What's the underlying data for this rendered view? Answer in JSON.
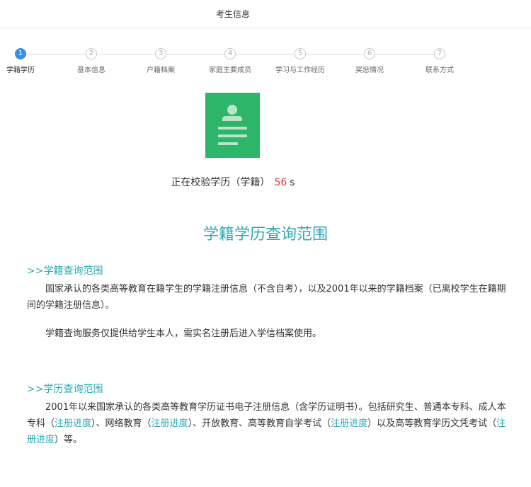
{
  "header": {
    "title": "考生信息"
  },
  "steps": [
    {
      "num": "1",
      "label": "学籍学历",
      "active": true
    },
    {
      "num": "2",
      "label": "基本信息",
      "active": false
    },
    {
      "num": "3",
      "label": "户籍档案",
      "active": false
    },
    {
      "num": "4",
      "label": "家庭主要成员",
      "active": false
    },
    {
      "num": "5",
      "label": "学习与工作经历",
      "active": false
    },
    {
      "num": "6",
      "label": "奖惩情况",
      "active": false
    },
    {
      "num": "7",
      "label": "联系方式",
      "active": false
    }
  ],
  "verify": {
    "text": "正在校验学历（学籍）",
    "count": "56",
    "unit": "s"
  },
  "main": {
    "title": "学籍学历查询范围",
    "xueji": {
      "heading": ">>学籍查询范围",
      "p1": "国家承认的各类高等教育在籍学生的学籍注册信息（不含自考），以及2001年以来的学籍档案（已离校学生在籍期间的学籍注册信息）。",
      "p2": "学籍查询服务仅提供给学生本人，需实名注册后进入学信档案使用。"
    },
    "xueli": {
      "heading": ">>学历查询范围",
      "seg1": "2001年以来国家承认的各类高等教育学历证书电子注册信息（含学历证明书）。包括研究生、普通本专科、成人本专科（",
      "link": "注册进度",
      "seg2": "）、网络教育（",
      "seg3": "）、开放教育、高等教育自学考试（",
      "seg4": "）以及高等教育学历文凭考试（",
      "seg5": "）等。"
    }
  },
  "colors": {
    "accent": "#2fa9b4",
    "active_step": "#3590e6",
    "icon_green": "#2db56a",
    "countdown": "#e03b3b"
  }
}
